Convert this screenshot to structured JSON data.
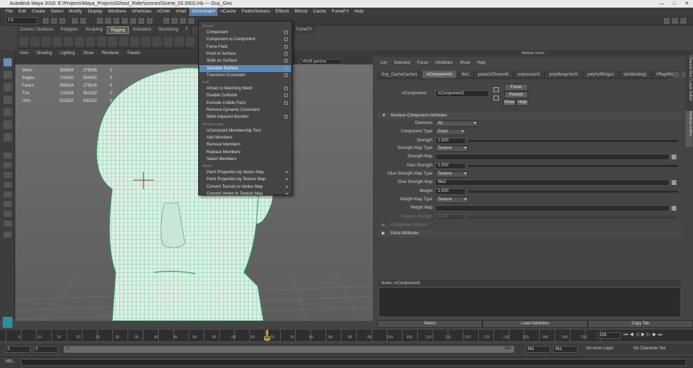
{
  "window": {
    "title": "Autodesk Maya 2016: E:\\Projects\\Maya_Projects\\Ghost_Rider\\scenes\\Scene_02.0002.mb  ---  Guy_Geo",
    "controls": [
      "—",
      "□",
      "✕"
    ]
  },
  "menu_bar": [
    "File",
    "Edit",
    "Create",
    "Select",
    "Modify",
    "Display",
    "Windows",
    "nParticles",
    "nCloth",
    "nHair",
    "nConstraint",
    "nCache",
    "Fields/Solvers",
    "Effects",
    "Bifrost",
    "Cache",
    "FumeFX",
    "Help"
  ],
  "status_line": {
    "mode": "FX"
  },
  "shelf_tabs": [
    "Curves / Surfaces",
    "Polygons",
    "Sculpting",
    "Rigging",
    "Animation",
    "Rendering",
    "F"
  ],
  "shelf_tabs_right": [
    "FumeFX"
  ],
  "viewport": {
    "menus": [
      "View",
      "Shading",
      "Lighting",
      "Show",
      "Renderer",
      "Panels"
    ],
    "color_space": "sRGB gamma",
    "hud": [
      {
        "label": "Verts:",
        "a": "355954",
        "b": "278935",
        "c": "0"
      },
      {
        "label": "Edges:",
        "a": "716320",
        "b": "554452",
        "c": "0"
      },
      {
        "label": "Faces:",
        "a": "356524",
        "b": "275616",
        "c": "0"
      },
      {
        "label": "Tris:",
        "a": "713154",
        "b": "551232",
        "c": "0"
      },
      {
        "label": "UVs:",
        "a": "513252",
        "b": "432011",
        "c": "0"
      }
    ]
  },
  "nconstraint_menu": {
    "items": [
      {
        "label": "Create",
        "type": "header"
      },
      {
        "label": "Component",
        "type": "box"
      },
      {
        "label": "Component to Component",
        "type": "box"
      },
      {
        "label": "Force Field",
        "type": "box"
      },
      {
        "label": "Point to Surface",
        "type": "box"
      },
      {
        "label": "Slide on Surface",
        "type": "box"
      },
      {
        "label": "Tearable Surface",
        "type": "box",
        "selected": true
      },
      {
        "label": "Transform Constraint",
        "type": "box"
      },
      {
        "label": "Edit",
        "type": "header"
      },
      {
        "label": "Attract to Matching Mesh",
        "type": "box"
      },
      {
        "label": "Disable Collision",
        "type": "box"
      },
      {
        "label": "Exclude Collide Pairs",
        "type": "box"
      },
      {
        "label": "Remove Dynamic Constraint",
        "type": "plain"
      },
      {
        "label": "Weld Adjacent Borders",
        "type": "box"
      },
      {
        "label": "Membership",
        "type": "header"
      },
      {
        "label": "nConstraint Membership Tool",
        "type": "plain"
      },
      {
        "label": "Add Members",
        "type": "plain"
      },
      {
        "label": "Remove Members",
        "type": "plain"
      },
      {
        "label": "Replace Members",
        "type": "plain"
      },
      {
        "label": "Select Members",
        "type": "plain"
      },
      {
        "label": "Maps",
        "type": "header"
      },
      {
        "label": "Paint Properties by Vertex Map",
        "type": "sub"
      },
      {
        "label": "Paint Properties by Texture Map",
        "type": "sub"
      },
      {
        "label": "Convert Texture to Vertex Map",
        "type": "sub"
      },
      {
        "label": "Convert Vertex to Texture Map",
        "type": "sub"
      }
    ]
  },
  "attribute_editor": {
    "title": "Attribute Editor",
    "menus": [
      "List",
      "Selected",
      "Focus",
      "Attributes",
      "Show",
      "Help"
    ],
    "tabs": [
      "Guy_CacheCache1",
      "nComponent1",
      "file2",
      "place2dTexture5",
      "expression2",
      "polyMergeVert1",
      "polySoftEdge1",
      "skinBinding1",
      "VRayMtl1"
    ],
    "node_label": "nComponent:",
    "node_name": "nComponent1",
    "buttons": {
      "focus": "Focus",
      "presets": "Presets",
      "show": "Show",
      "hide": "Hide"
    },
    "section_title": "Nucleus Component Attributes",
    "rows": {
      "elements": {
        "label": "Elements",
        "value": "All"
      },
      "component_type": {
        "label": "Component Type",
        "value": "Point"
      },
      "strength": {
        "label": "Strength",
        "value": "1.000"
      },
      "strength_map_type": {
        "label": "Strength Map Type",
        "value": "Texture"
      },
      "strength_map": {
        "label": "Strength Map",
        "value": ""
      },
      "glue_strength": {
        "label": "Glue Strength",
        "value": "1.000"
      },
      "glue_strength_map_type": {
        "label": "Glue Strength Map Type",
        "value": "Texture"
      },
      "glue_strength_map": {
        "label": "Glue Strength Map",
        "value": "file3"
      },
      "weight": {
        "label": "Weight",
        "value": "1.000"
      },
      "weight_map_type": {
        "label": "Weight Map Type",
        "value": "Texture"
      },
      "weight_map": {
        "label": "Weight Map",
        "value": ""
      },
      "tangent_strength": {
        "label": "Tangent Strength",
        "value": "0.100"
      }
    },
    "collapsed_sections": [
      "Component Indices",
      "Extra Attributes"
    ],
    "notes_label": "Notes:  nComponent1",
    "bottom_buttons": [
      "Select",
      "Load Attributes",
      "Copy Tab"
    ],
    "side_tabs": [
      "Channel Box / Layer Editor",
      "Attribute Editor"
    ]
  },
  "timeline": {
    "ticks": [
      "5",
      "10",
      "15",
      "20",
      "25",
      "30",
      "35",
      "40",
      "45",
      "50",
      "55",
      "60",
      "65",
      "70",
      "75",
      "80",
      "85",
      "90",
      "95",
      "100",
      "105",
      "110",
      "115",
      "120",
      "125",
      "130",
      "135",
      "140",
      "145",
      "150",
      "155"
    ],
    "current_frame": "59",
    "current_frame_field": "159"
  },
  "range": {
    "start": "0",
    "playback_start": "0",
    "range_start": "0",
    "range_end": "361",
    "playback_end": "361",
    "end": "361",
    "anim_layer": "No Anim Layer",
    "character_set": "No Character Set"
  },
  "command_line": {
    "label": "MEL"
  },
  "colors": {
    "accent": "#5a8bb8",
    "mesh_fill": "#d8efe4",
    "mesh_wire": "#3fbf7a"
  }
}
